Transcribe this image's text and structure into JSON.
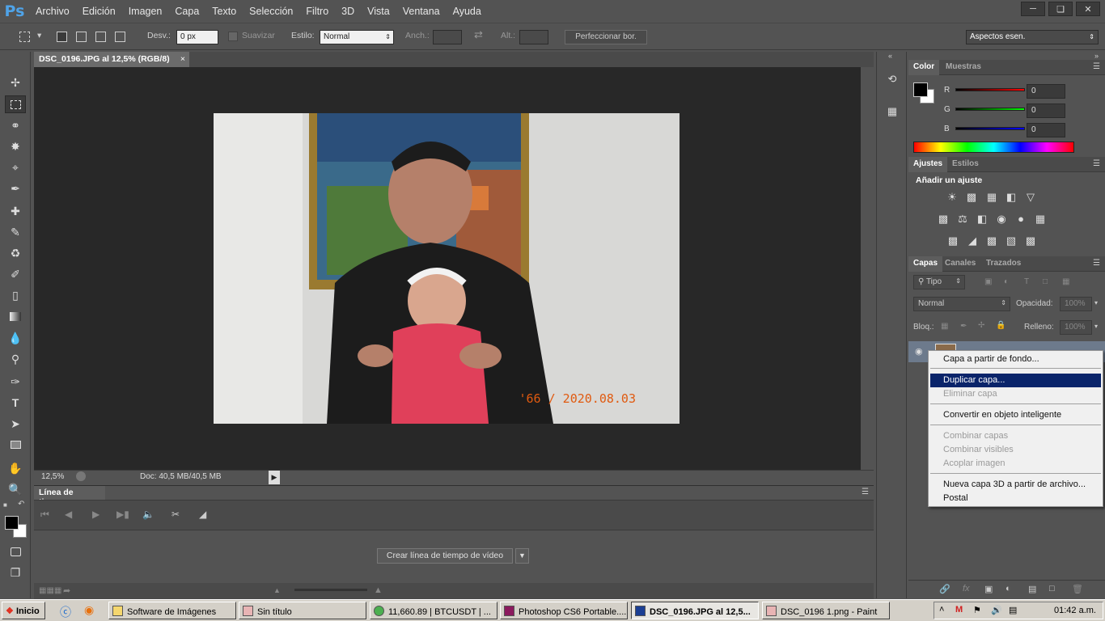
{
  "app": {
    "logo": "Ps",
    "menu": [
      "Archivo",
      "Edición",
      "Imagen",
      "Capa",
      "Texto",
      "Selección",
      "Filtro",
      "3D",
      "Vista",
      "Ventana",
      "Ayuda"
    ],
    "window_controls": [
      "minimize",
      "restore",
      "close"
    ]
  },
  "options_bar": {
    "desvanecer_label": "Desv.:",
    "desvanecer_value": "0 px",
    "suavizar_label": "Suavizar",
    "estilo_label": "Estilo:",
    "estilo_value": "Normal",
    "anch_label": "Anch.:",
    "alt_label": "Alt.:",
    "refine_button": "Perfeccionar bor.",
    "workspace": "Aspectos esen."
  },
  "document": {
    "tab_title": "DSC_0196.JPG al 12,5% (RGB/8)",
    "photo_stamp": "'66 / 2020.08.03",
    "zoom": "12,5%",
    "doc_size": "Doc: 40,5 MB/40,5 MB"
  },
  "timeline": {
    "tab_label": "Línea de tiempo",
    "create_button": "Crear línea de tiempo de vídeo"
  },
  "color_panel": {
    "tabs": [
      "Color",
      "Muestras"
    ],
    "channels": [
      {
        "label": "R",
        "value": "0",
        "color": "#ff0000"
      },
      {
        "label": "G",
        "value": "0",
        "color": "#00ff00"
      },
      {
        "label": "B",
        "value": "0",
        "color": "#0000ff"
      }
    ]
  },
  "adjustments_panel": {
    "tabs": [
      "Ajustes",
      "Estilos"
    ],
    "heading": "Añadir un ajuste"
  },
  "layers_panel": {
    "tabs": [
      "Capas",
      "Canales",
      "Trazados"
    ],
    "filter_label": "Tipo",
    "blend_mode": "Normal",
    "opacity_label": "Opacidad:",
    "opacity_value": "100%",
    "lock_label": "Bloq.:",
    "fill_label": "Relleno:",
    "fill_value": "100%"
  },
  "context_menu": {
    "items": [
      {
        "label": "Capa a partir de fondo...",
        "state": "normal"
      },
      {
        "label": "Duplicar capa...",
        "state": "highlighted"
      },
      {
        "label": "Eliminar capa",
        "state": "disabled"
      },
      {
        "label": "Convertir en objeto inteligente",
        "state": "normal"
      },
      {
        "label": "Combinar capas",
        "state": "disabled"
      },
      {
        "label": "Combinar visibles",
        "state": "disabled"
      },
      {
        "label": "Acoplar imagen",
        "state": "disabled"
      },
      {
        "label": "Nueva capa 3D a partir de archivo...",
        "state": "normal"
      },
      {
        "label": "Postal",
        "state": "normal"
      }
    ]
  },
  "taskbar": {
    "start": "Inicio",
    "buttons": [
      {
        "label": "Software de Imágenes",
        "icon": "folder-icon",
        "color": "#f5d76e"
      },
      {
        "label": "Sin título",
        "icon": "paint-icon",
        "color": "#e8b4b4"
      },
      {
        "label": "11,660.89 | BTCUSDT | ...",
        "icon": "chrome-icon",
        "color": "#4caf50"
      },
      {
        "label": "Photoshop CS6 Portable....",
        "icon": "winrar-icon",
        "color": "#8b1a5e"
      },
      {
        "label": "DSC_0196.JPG al 12,5...",
        "icon": "photoshop-icon",
        "color": "#1c3f94"
      },
      {
        "label": "DSC_0196 1.png - Paint",
        "icon": "paint-icon",
        "color": "#e8b4b4"
      }
    ],
    "clock": "01:42 a.m."
  }
}
